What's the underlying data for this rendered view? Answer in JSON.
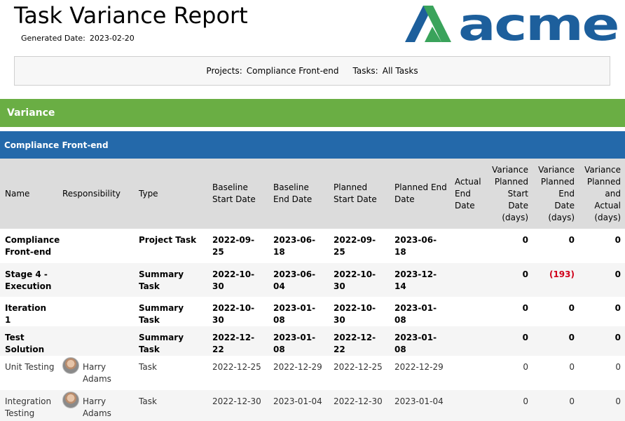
{
  "header": {
    "title": "Task Variance Report",
    "generated_label": "Generated Date:",
    "generated_value": "2023-02-20",
    "logo_text": "acme"
  },
  "filters": {
    "projects_label": "Projects:",
    "projects_value": "Compliance Front-end",
    "tasks_label": "Tasks:",
    "tasks_value": "All Tasks"
  },
  "section_title": "Variance",
  "project_title": "Compliance Front-end",
  "colors": {
    "variance_bar": "#6aae44",
    "project_bar": "#2469aa",
    "negative": "#d0021b",
    "logo_green": "#3aa35b",
    "logo_blue": "#1d5f9c"
  },
  "columns": [
    "Name",
    "Responsibility",
    "Type",
    "Baseline Start Date",
    "Baseline End Date",
    "Planned Start Date",
    "Planned End Date",
    "Actual End Date",
    "Variance Planned Start Date (days)",
    "Variance Planned End Date (days)",
    "Variance Planned and Actual (days)"
  ],
  "rows": [
    {
      "name": "Compliance Front-end",
      "responsibility": "",
      "type": "Project Task",
      "baseline_start": "2022-09-25",
      "baseline_end": "2023-06-18",
      "planned_start": "2022-09-25",
      "planned_end": "2023-06-18",
      "actual_end": "",
      "var_start": "0",
      "var_end": "0",
      "var_actual": "0"
    },
    {
      "name": "Stage 4 - Execution",
      "responsibility": "",
      "type": "Summary Task",
      "baseline_start": "2022-10-30",
      "baseline_end": "2023-06-04",
      "planned_start": "2022-10-30",
      "planned_end": "2023-12-14",
      "actual_end": "",
      "var_start": "0",
      "var_end": "(193)",
      "var_actual": "0"
    },
    {
      "name": "Iteration 1",
      "responsibility": "",
      "type": "Summary Task",
      "baseline_start": "2022-10-30",
      "baseline_end": "2023-01-08",
      "planned_start": "2022-10-30",
      "planned_end": "2023-01-08",
      "actual_end": "",
      "var_start": "0",
      "var_end": "0",
      "var_actual": "0"
    },
    {
      "name": "Test Solution",
      "responsibility": "",
      "type": "Summary Task",
      "baseline_start": "2022-12-22",
      "baseline_end": "2023-01-08",
      "planned_start": "2022-12-22",
      "planned_end": "2023-01-08",
      "actual_end": "",
      "var_start": "0",
      "var_end": "0",
      "var_actual": "0"
    },
    {
      "name": "Unit Testing",
      "responsibility": "Harry Adams",
      "type": "Task",
      "baseline_start": "2022-12-25",
      "baseline_end": "2022-12-29",
      "planned_start": "2022-12-25",
      "planned_end": "2022-12-29",
      "actual_end": "",
      "var_start": "0",
      "var_end": "0",
      "var_actual": "0"
    },
    {
      "name": "Integration Testing",
      "responsibility": "Harry Adams",
      "type": "Task",
      "baseline_start": "2022-12-30",
      "baseline_end": "2023-01-04",
      "planned_start": "2022-12-30",
      "planned_end": "2023-01-04",
      "actual_end": "",
      "var_start": "0",
      "var_end": "0",
      "var_actual": "0"
    }
  ]
}
